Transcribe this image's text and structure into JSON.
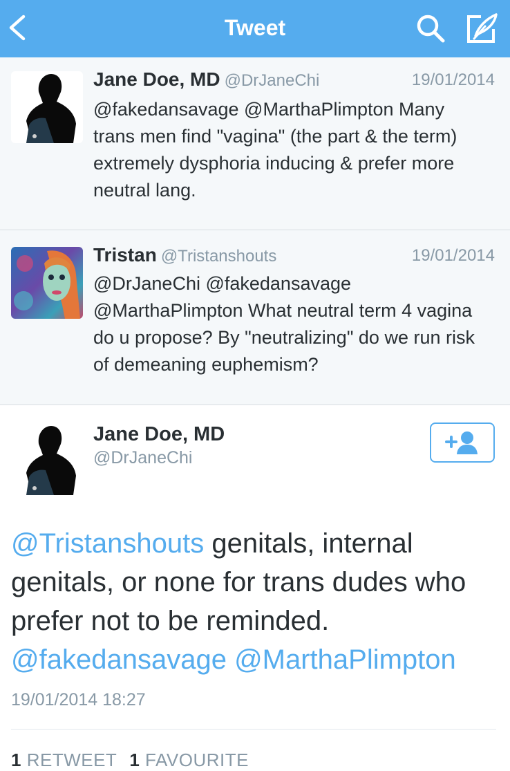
{
  "nav": {
    "title": "Tweet",
    "back_icon": "chevron-left-icon",
    "search_icon": "search-icon",
    "compose_icon": "compose-icon",
    "bg_color": "#55acee"
  },
  "replies": [
    {
      "name": "Jane Doe, MD",
      "handle": "@DrJaneChi",
      "date": "19/01/2014",
      "text": "@fakedansavage @MarthaPlimpton Many trans men find \"vagina\" (the part & the term) extremely dysphoria inducing & prefer more neutral lang."
    },
    {
      "name": "Tristan",
      "handle": "@Tristanshouts",
      "date": "19/01/2014",
      "text": "@DrJaneChi @fakedansavage @MarthaPlimpton What neutral term 4 vagina do u propose? By \"neutralizing\" do we run risk of demeaning euphemism?"
    }
  ],
  "main_tweet": {
    "name": "Jane Doe, MD",
    "handle": "@DrJaneChi",
    "mention1": "@Tristanshouts",
    "body": " genitals, internal genitals, or none for trans dudes who prefer not to be reminded.",
    "mention2": "@fakedansavage",
    "mention3": "@MarthaPlimpton",
    "timestamp": "19/01/2014 18:27",
    "follow_icon": "add-user-icon",
    "retweet_count": "1",
    "retweet_label": "RETWEET",
    "favourite_count": "1",
    "favourite_label": "FAVOURITE",
    "link_color": "#55acee"
  }
}
